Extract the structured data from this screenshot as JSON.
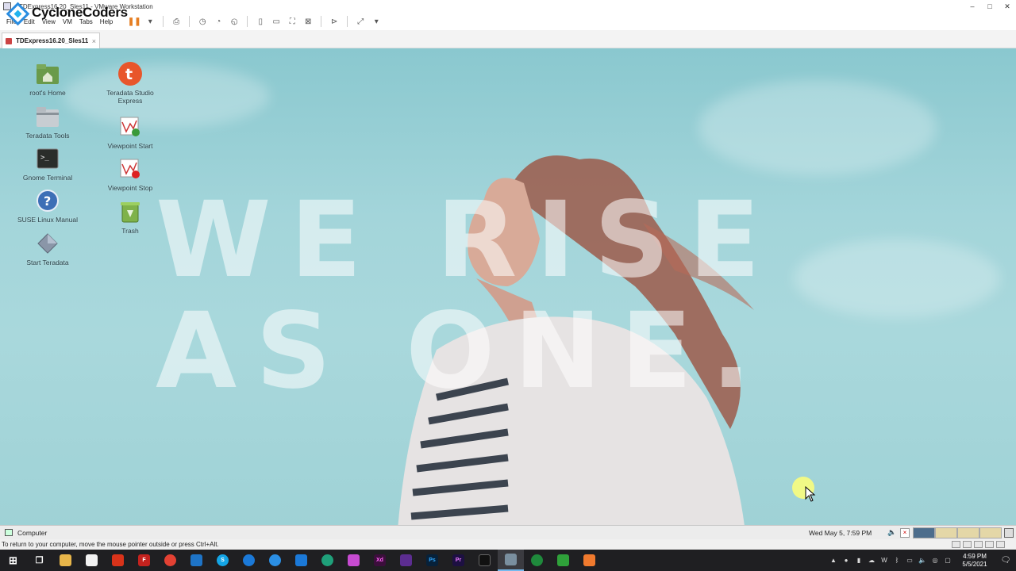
{
  "window": {
    "title": "TDExpress16.20_Sles11 - VMware Workstation",
    "controls": [
      "–",
      "□",
      "✕"
    ]
  },
  "logo": {
    "text": "CycloneCoders"
  },
  "menu": {
    "items": [
      "File",
      "Edit",
      "View",
      "VM",
      "Tabs",
      "Help"
    ]
  },
  "tab": {
    "label": "TDExpress16.20_Sles11",
    "close": "×"
  },
  "desktop": {
    "slogan_line1": "WE RISE",
    "slogan_line2": "AS ONE.",
    "icons": [
      {
        "label": "root's Home",
        "icon": "home-folder-icon"
      },
      {
        "label": "Teradata Tools",
        "icon": "folder-icon"
      },
      {
        "label": "Gnome Terminal",
        "icon": "terminal-icon"
      },
      {
        "label": "SUSE Linux Manual",
        "icon": "help-icon"
      },
      {
        "label": "Start Teradata",
        "icon": "diamond-icon"
      },
      {
        "label": "Teradata Studio Express",
        "icon": "teradata-t-icon"
      },
      {
        "label": "Viewpoint Start",
        "icon": "viewpoint-start-icon"
      },
      {
        "label": "Viewpoint Stop",
        "icon": "viewpoint-stop-icon"
      },
      {
        "label": "Trash",
        "icon": "trash-icon"
      }
    ]
  },
  "guest_panel": {
    "computer_label": "Computer",
    "clock": "Wed May  5,  7:59 PM",
    "net_mark": "×"
  },
  "vm_status": {
    "message": "To return to your computer, move the mouse pointer outside or press Ctrl+Alt."
  },
  "taskbar": {
    "apps": [
      {
        "name": "windows-start-icon",
        "glyph": "⊞",
        "color": "#1f1f22"
      },
      {
        "name": "task-view-icon",
        "glyph": "❐",
        "color": "#1f1f22"
      },
      {
        "name": "file-explorer-icon",
        "glyph": "",
        "color": "#e8b64a"
      },
      {
        "name": "store-icon",
        "glyph": "",
        "color": "#f2f2f2"
      },
      {
        "name": "office-icon",
        "glyph": "",
        "color": "#d9331a"
      },
      {
        "name": "filezilla-icon",
        "glyph": "F",
        "color": "#c4221e"
      },
      {
        "name": "chrome-icon",
        "glyph": "",
        "color": "#e34133"
      },
      {
        "name": "vscode-icon",
        "glyph": "",
        "color": "#1e74c7"
      },
      {
        "name": "skype-icon",
        "glyph": "S",
        "color": "#14a5e6"
      },
      {
        "name": "teamviewer-icon",
        "glyph": "",
        "color": "#1b79d8"
      },
      {
        "name": "edge-legacy-icon",
        "glyph": "",
        "color": "#2b8fe4"
      },
      {
        "name": "mail-icon",
        "glyph": "",
        "color": "#1b79d8"
      },
      {
        "name": "edge-icon",
        "glyph": "",
        "color": "#1fa07a"
      },
      {
        "name": "app-purple-icon",
        "glyph": "",
        "color": "#c74bd1"
      },
      {
        "name": "adobe-xd-icon",
        "glyph": "Xd",
        "color": "#3c0e3c"
      },
      {
        "name": "visual-studio-icon",
        "glyph": "",
        "color": "#5c2d91"
      },
      {
        "name": "photoshop-icon",
        "glyph": "Ps",
        "color": "#07213a"
      },
      {
        "name": "premiere-icon",
        "glyph": "Pr",
        "color": "#1d1042"
      },
      {
        "name": "terminal-app-icon",
        "glyph": "",
        "color": "#111"
      },
      {
        "name": "vmware-icon",
        "glyph": "",
        "color": "#7a8f9f"
      },
      {
        "name": "app-green-icon",
        "glyph": "",
        "color": "#1f8a3c"
      },
      {
        "name": "xbox-icon",
        "glyph": "",
        "color": "#2fa13a"
      },
      {
        "name": "app-orange-icon",
        "glyph": "",
        "color": "#f07a2e"
      }
    ],
    "time": "4:59 PM",
    "date": "5/5/2021"
  }
}
